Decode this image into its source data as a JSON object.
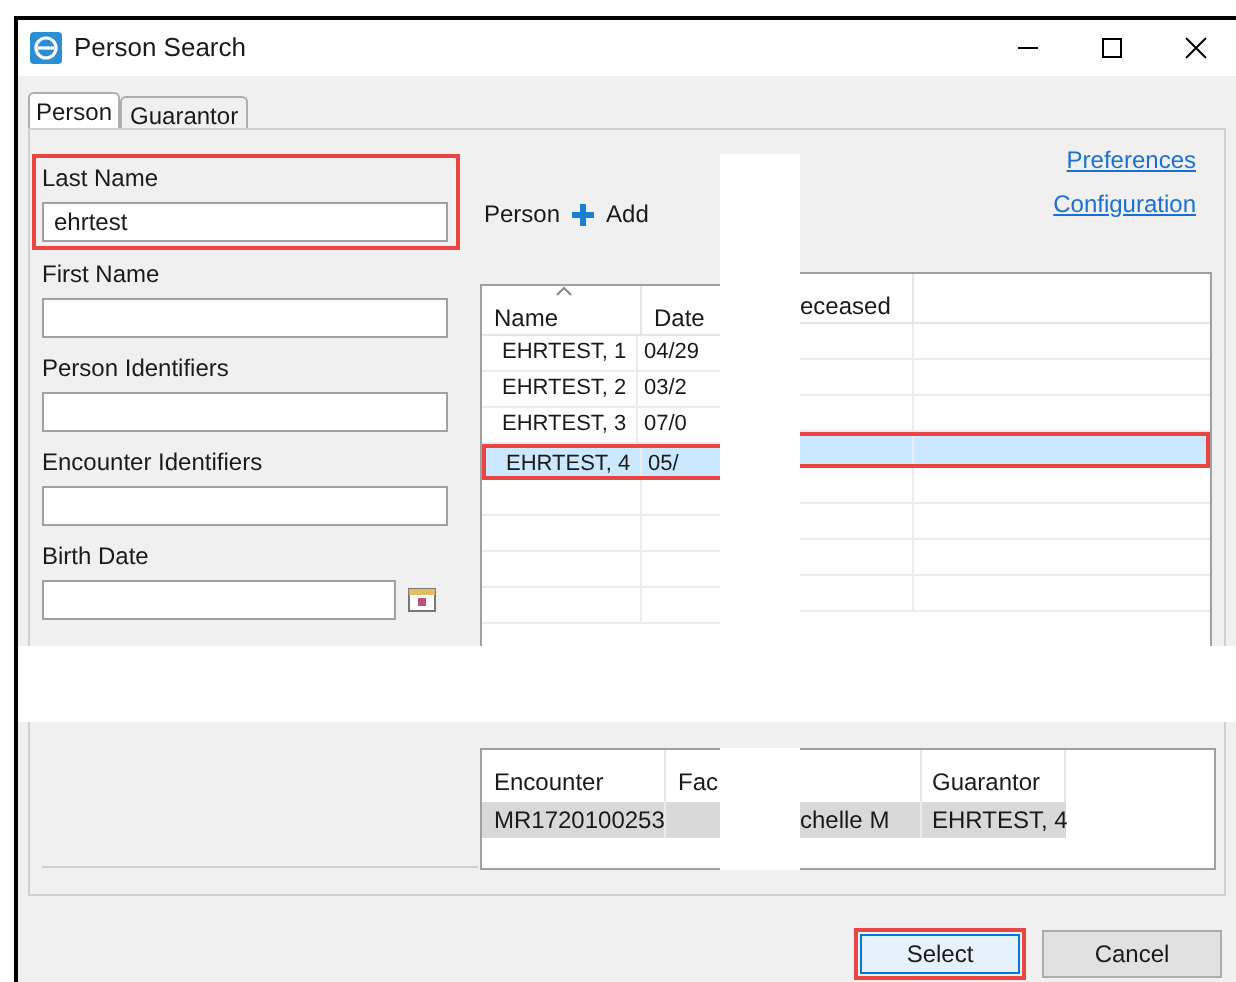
{
  "window": {
    "title": "Person Search"
  },
  "tabs": [
    {
      "label": "Person",
      "selected": true
    },
    {
      "label": "Guarantor",
      "selected": false
    }
  ],
  "form": [
    {
      "label": "Last Name",
      "value": "ehrtest",
      "highlighted": true
    },
    {
      "label": "First Name",
      "highlighted": false
    },
    {
      "label": "Person Identifiers",
      "highlighted": false
    },
    {
      "label": "Encounter Identifiers",
      "highlighted": false
    },
    {
      "label": "Birth Date",
      "kind": "date",
      "highlighted": false
    }
  ],
  "person_toolbar": {
    "label": "Person",
    "add": "Add"
  },
  "links": [
    "Preferences",
    "Configuration"
  ],
  "person_table": {
    "columns": {
      "name": "Name",
      "date": "Date",
      "column_3": "eceased"
    },
    "rows": [
      {
        "name": "EHRTEST, 1",
        "date": "04/29",
        "selected": false,
        "highlighted": false
      },
      {
        "name": "EHRTEST, 2",
        "date": "03/2",
        "selected": false,
        "highlighted": false
      },
      {
        "name": "EHRTEST, 3",
        "date": "07/0",
        "selected": false,
        "highlighted": false
      },
      {
        "name": "EHRTEST, 4",
        "date": "05/",
        "selected": true,
        "highlighted": true
      }
    ]
  },
  "encounter_table": {
    "columns": {
      "encounter": "Encounter",
      "column_2": "Fac",
      "guarantor": "Guarantor"
    },
    "rows": [
      {
        "encounter": "MR1720100253",
        "column_3": "chelle M",
        "guarantor": "EHRTEST, 4",
        "selected": true
      }
    ]
  },
  "buttons": [
    {
      "label": "Select",
      "highlighted": true
    },
    {
      "label": "Cancel",
      "highlighted": false
    }
  ]
}
